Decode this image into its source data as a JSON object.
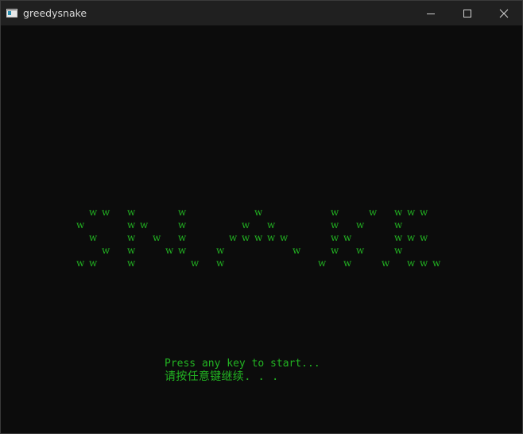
{
  "window": {
    "title": "greedysnake",
    "icon": "console-app-icon",
    "controls": [
      "minimize-icon",
      "maximize-icon",
      "close-icon"
    ]
  },
  "console": {
    "text_color": "#22b422",
    "background": "#0c0c0c",
    "banner_glyph": "w",
    "banner_rows": [
      "  w w   w       w           w           w     w   w w w",
      "w       w w     w         w   w         w   w     w    ",
      "  w     w   w   w       w w w w w       w w       w w w",
      "    w   w     w w     w           w     w   w     w    ",
      "w w     w         w   w               w   w     w   w w w"
    ],
    "press_any_key": "Press any key to start...",
    "press_any_key_cn": "请按任意键继续. . ."
  }
}
